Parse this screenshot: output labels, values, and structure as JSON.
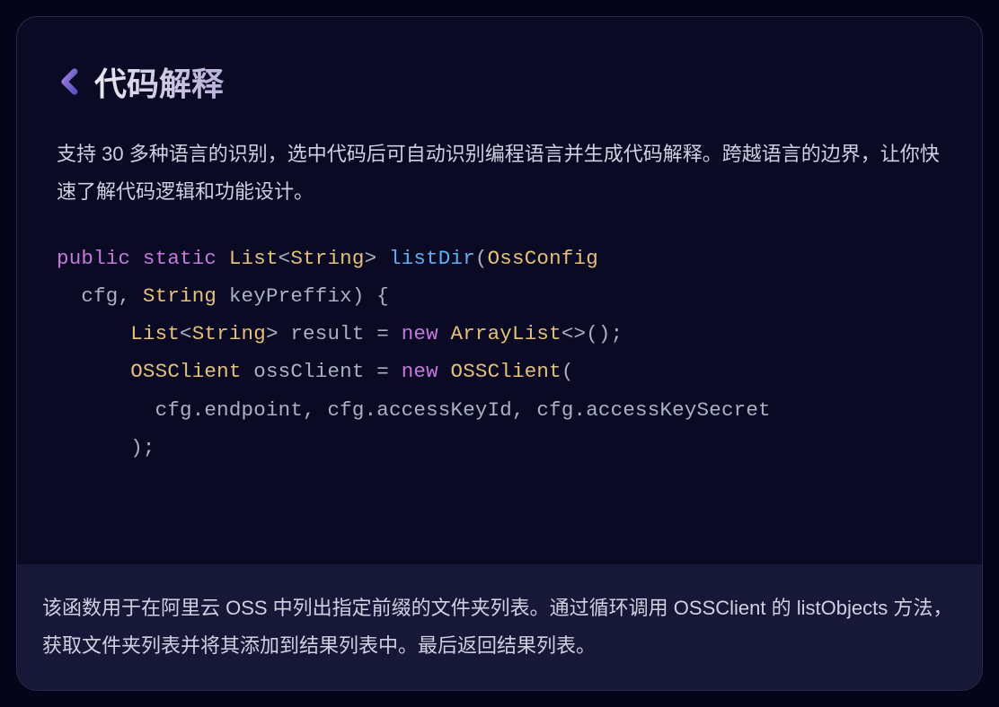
{
  "header": {
    "title": "代码解释"
  },
  "description": "支持 30 多种语言的识别，选中代码后可自动识别编程语言并生成代码解释。跨越语言的边界，让你快速了解代码逻辑和功能设计。",
  "code": {
    "kw_public": "public",
    "sp1": " ",
    "kw_static": "static",
    "sp2": " ",
    "type_list1": "List",
    "lt1": "<",
    "type_string1": "String",
    "gt1": ">",
    "sp3": " ",
    "method_name": "listDir",
    "lparen1": "(",
    "type_ossconfig": "OssConfig",
    "nl1": "\n  ",
    "param_cfg": "cfg",
    "comma1": ", ",
    "type_string2": "String",
    "sp4": " ",
    "param_keypreffix": "keyPreffix",
    "rparen1": ")",
    "sp5": " ",
    "lbrace": "{",
    "nl2": "\n      ",
    "type_list2": "List",
    "lt2": "<",
    "type_string3": "String",
    "gt2": ">",
    "sp6": " ",
    "var_result": "result",
    "sp7": " ",
    "eq1": "=",
    "sp8": " ",
    "kw_new1": "new",
    "sp9": " ",
    "type_arraylist": "ArrayList",
    "diamond": "<>",
    "parens1": "()",
    "semi1": ";",
    "nl3": "\n      ",
    "type_ossclient1": "OSSClient",
    "sp10": " ",
    "var_ossclient": "ossClient",
    "sp11": " ",
    "eq2": "=",
    "sp12": " ",
    "kw_new2": "new",
    "sp13": " ",
    "type_ossclient2": "OSSClient",
    "lparen2": "(",
    "nl4": "\n        ",
    "arg1": "cfg.endpoint",
    "comma2": ", ",
    "arg2": "cfg.accessKeyId",
    "comma3": ", ",
    "arg3": "cfg.accessKeySecret",
    "nl5": "\n      ",
    "rparen2": ")",
    "semi2": ";"
  },
  "explanation": "该函数用于在阿里云 OSS 中列出指定前缀的文件夹列表。通过循环调用 OSSClient 的 listObjects 方法，获取文件夹列表并将其添加到结果列表中。最后返回结果列表。"
}
